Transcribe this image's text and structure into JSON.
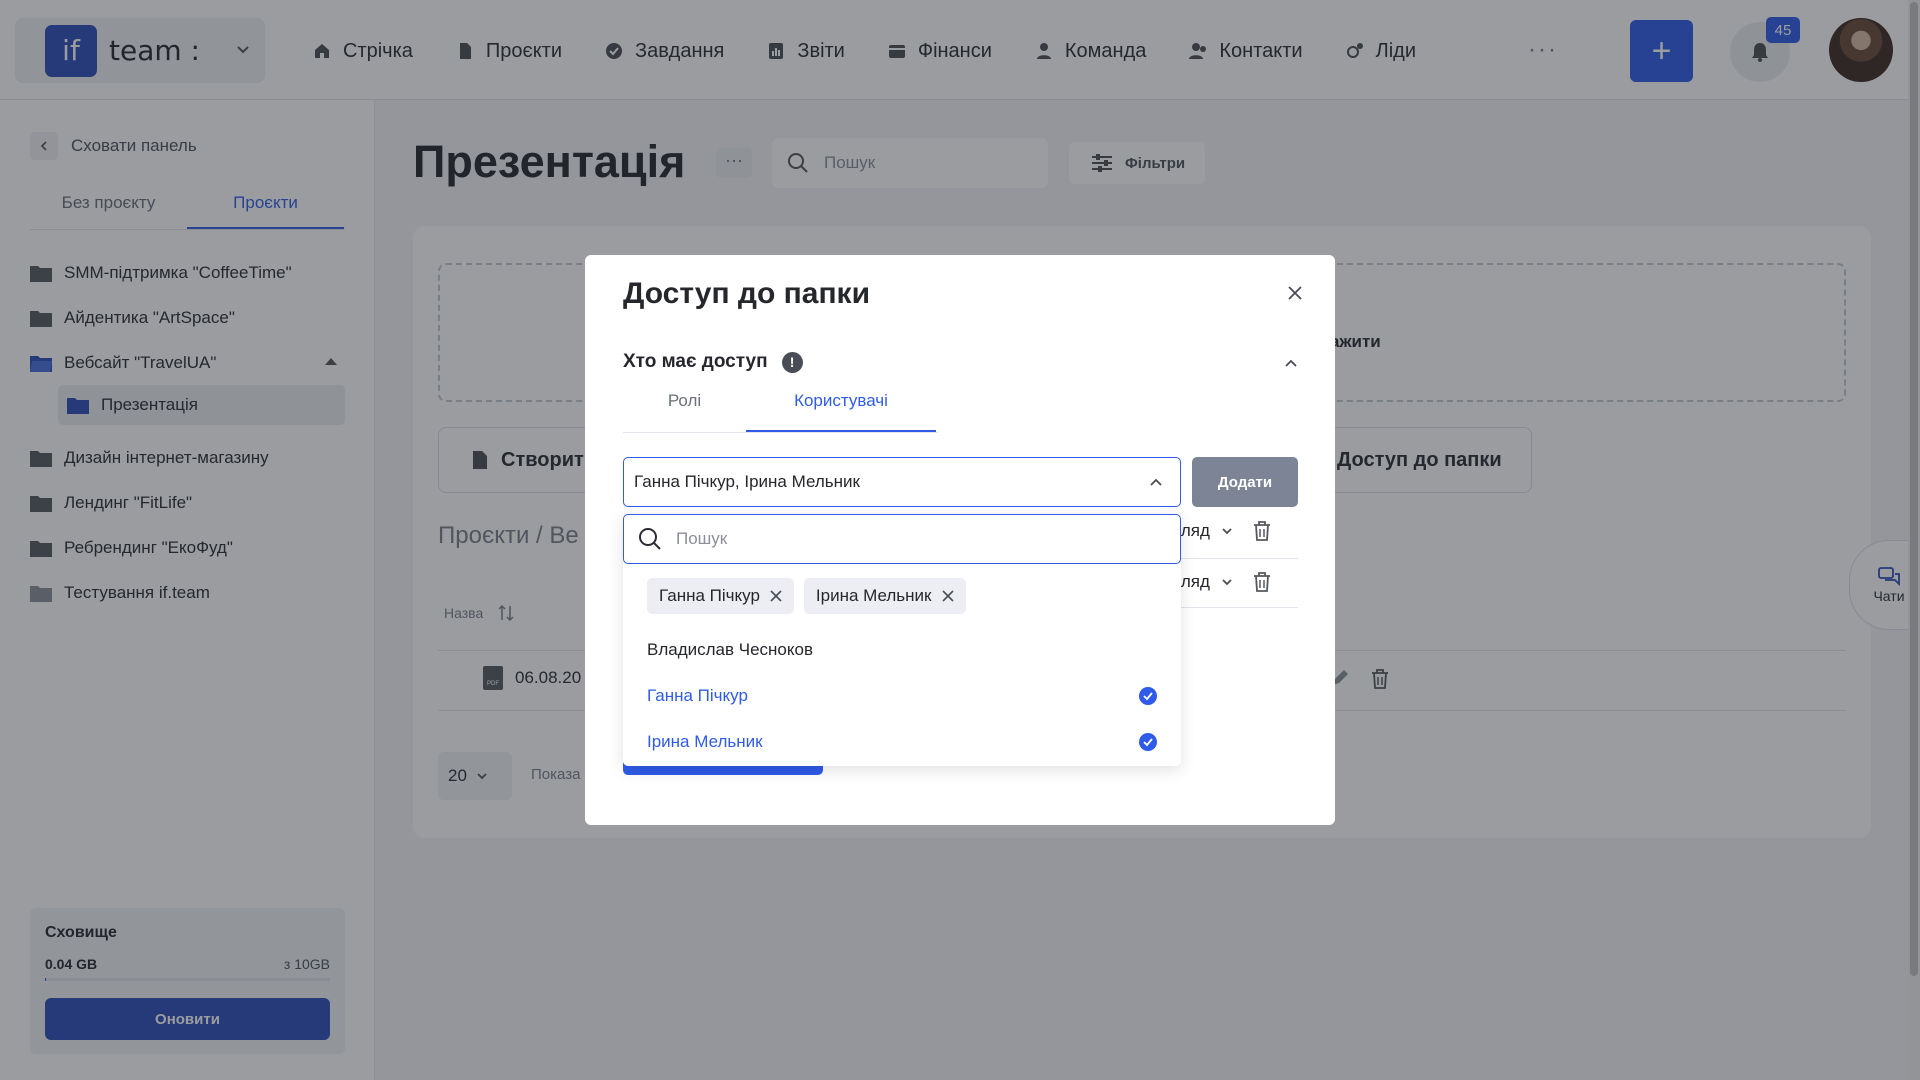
{
  "app": {
    "logo_text": "if",
    "name": "team :"
  },
  "nav": [
    {
      "label": "Стрічка",
      "icon": "home-icon"
    },
    {
      "label": "Проєкти",
      "icon": "document-icon"
    },
    {
      "label": "Завдання",
      "icon": "check-circle-icon"
    },
    {
      "label": "Звіти",
      "icon": "report-icon"
    },
    {
      "label": "Фінанси",
      "icon": "wallet-icon"
    },
    {
      "label": "Команда",
      "icon": "user-icon"
    },
    {
      "label": "Контакти",
      "icon": "contacts-icon"
    },
    {
      "label": "Ліди",
      "icon": "leads-icon"
    }
  ],
  "header": {
    "more": "···",
    "plus": "+",
    "notifications_count": "45"
  },
  "sidebar": {
    "hide_label": "Сховати панель",
    "tabs": [
      "Без проєкту",
      "Проєкти"
    ],
    "active_tab": "Проєкти",
    "projects": [
      "SMM-підтримка \"CoffeeTime\"",
      "Айдентика \"ArtSpace\"",
      "Вебсайт \"TravelUA\"",
      "Презентація",
      "Дизайн інтернет-магазину",
      "Лендинг \"FitLife\"",
      "Ребрендинг \"ЕкоФуд\"",
      "Тестування if.team"
    ],
    "storage": {
      "title": "Сховище",
      "used": "0.04 GB",
      "total": "з 10GB",
      "used_fraction": 0.004,
      "button": "Оновити"
    }
  },
  "main": {
    "title": "Презентація",
    "title_more": "···",
    "search_placeholder": "Пошук",
    "filters_label": "Фільтри",
    "dropzone_text": "ажити",
    "create_button": "Створити",
    "access_button": "Доступ до папки",
    "breadcrumb": "Проєкти / Ве",
    "column_name": "Назва",
    "file_date": "06.08.20",
    "per_page": "20",
    "shown_label": "Показа",
    "chat_label": "Чати"
  },
  "modal": {
    "title": "Доступ до папки",
    "who_label": "Хто має доступ",
    "info": "!",
    "tabs": [
      "Ролі",
      "Користувачі"
    ],
    "active_tab": "Користувачі",
    "selected_value": "Ганна Пічкур, Ірина Мельник",
    "add_button": "Додати",
    "rows": [
      {
        "permission": "гляд"
      },
      {
        "permission": "гляд"
      }
    ]
  },
  "dropdown": {
    "search_placeholder": "Пошук",
    "chips": [
      "Ганна Пічкур",
      "Ірина Мельник"
    ],
    "options": [
      {
        "label": "Владислав Чесноков",
        "selected": false
      },
      {
        "label": "Ганна Пічкур",
        "selected": true
      },
      {
        "label": "Ірина Мельник",
        "selected": true
      }
    ]
  },
  "colors": {
    "accent": "#2f5be8",
    "brand": "#2c4dbb",
    "muted_button": "#7d8496"
  }
}
